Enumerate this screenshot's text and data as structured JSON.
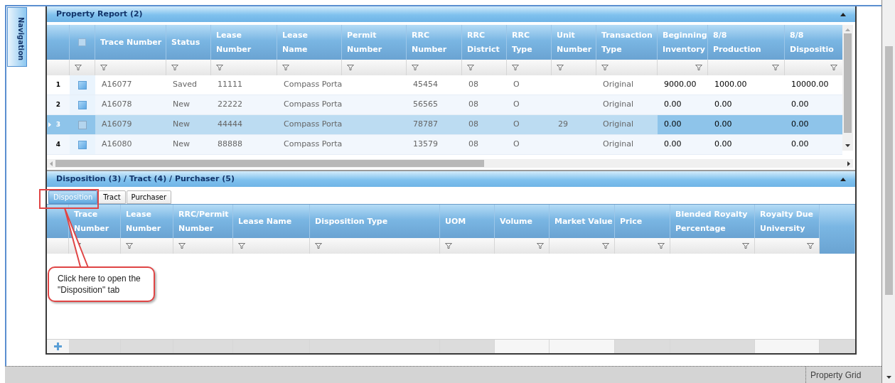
{
  "navigation": {
    "label": "Navigation"
  },
  "property_report": {
    "title": "Property Report (2)",
    "select_all": {
      "checked": false
    },
    "columns": [
      {
        "lines": [
          "Trace Number"
        ],
        "kind": "text"
      },
      {
        "lines": [
          "Status"
        ],
        "kind": "text"
      },
      {
        "lines": [
          "Lease",
          "Number"
        ],
        "kind": "text"
      },
      {
        "lines": [
          "Lease",
          "Name"
        ],
        "kind": "text"
      },
      {
        "lines": [
          "Permit",
          "Number"
        ],
        "kind": "text"
      },
      {
        "lines": [
          "RRC",
          "Number"
        ],
        "kind": "text"
      },
      {
        "lines": [
          "RRC",
          "District"
        ],
        "kind": "text"
      },
      {
        "lines": [
          "RRC",
          "Type"
        ],
        "kind": "text"
      },
      {
        "lines": [
          "Unit",
          "Number"
        ],
        "kind": "text"
      },
      {
        "lines": [
          "Transaction",
          "Type"
        ],
        "kind": "text"
      },
      {
        "lines": [
          "Beginning",
          "Inventory"
        ],
        "kind": "amount"
      },
      {
        "lines": [
          "8/8",
          "Production"
        ],
        "kind": "amount"
      },
      {
        "lines": [
          "8/8",
          "Dispositio"
        ],
        "kind": "amount"
      }
    ],
    "rows": [
      {
        "number": "1",
        "selected": false,
        "cells": [
          "A16077",
          "Saved",
          "11111",
          "Compass Porta",
          null,
          "45454",
          "08",
          "O",
          null,
          "Original",
          "9000.00",
          "1000.00",
          "10000.00"
        ]
      },
      {
        "number": "2",
        "selected": false,
        "cells": [
          "A16078",
          "New",
          "22222",
          "Compass Porta",
          null,
          "56565",
          "08",
          "O",
          null,
          "Original",
          "0.00",
          "0.00",
          "0.00"
        ]
      },
      {
        "number": "3",
        "selected": true,
        "cells": [
          "A16079",
          "New",
          "44444",
          "Compass Porta",
          null,
          "78787",
          "08",
          "O",
          "29",
          "Original",
          "0.00",
          "0.00",
          "0.00"
        ]
      },
      {
        "number": "4",
        "selected": false,
        "cells": [
          "A16080",
          "New",
          "88888",
          "Compass Porta",
          null,
          "13579",
          "08",
          "O",
          null,
          "Original",
          "0.00",
          "0.00",
          "0.00"
        ]
      }
    ]
  },
  "details": {
    "title": "Disposition (3) / Tract (4) / Purchaser (5)",
    "tabs": [
      {
        "label": "Disposition",
        "selected": true
      },
      {
        "label": "Tract",
        "selected": false
      },
      {
        "label": "Purchaser",
        "selected": false
      }
    ],
    "columns": [
      {
        "lines": [
          "Trace",
          "Number"
        ],
        "kind": "text"
      },
      {
        "lines": [
          "Lease",
          "Number"
        ],
        "kind": "text"
      },
      {
        "lines": [
          "RRC/Permit",
          "Number"
        ],
        "kind": "text"
      },
      {
        "lines": [
          "Lease Name"
        ],
        "kind": "text"
      },
      {
        "lines": [
          "Disposition Type"
        ],
        "kind": "text"
      },
      {
        "lines": [
          "UOM"
        ],
        "kind": "text"
      },
      {
        "lines": [
          "Volume"
        ],
        "kind": "amount"
      },
      {
        "lines": [
          "Market Value"
        ],
        "kind": "amount"
      },
      {
        "lines": [
          "Price"
        ],
        "kind": "amount"
      },
      {
        "lines": [
          "Blended Royalty",
          "Percentage"
        ],
        "kind": "amount"
      },
      {
        "lines": [
          "Royalty Due",
          "University"
        ],
        "kind": "amount"
      }
    ]
  },
  "callout": {
    "text": "Click here to open the \"Disposition\" tab"
  },
  "status_bar": {
    "panel": "Property Grid"
  }
}
